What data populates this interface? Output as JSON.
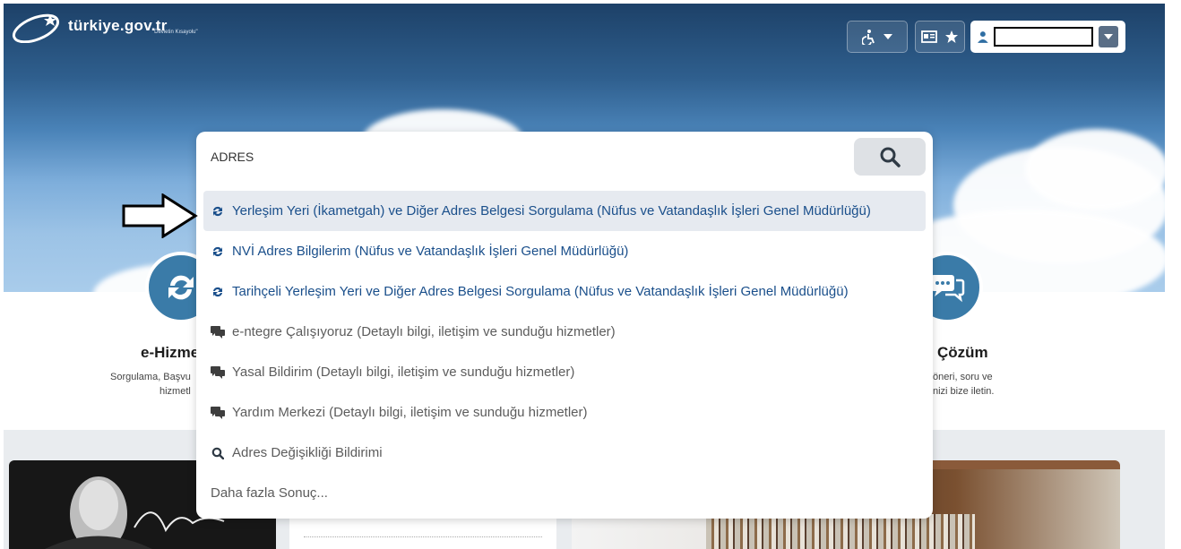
{
  "header": {
    "logo_text": "türkiye.gov.tr",
    "logo_subtext": "\"Devletin Kısayolu\"",
    "accessibility_icon": "accessibility-icon",
    "id_card_icon": "id-card-icon",
    "favorite_icon": "star-icon",
    "user_icon": "user-icon"
  },
  "services": {
    "left_title": "e-Hizmet",
    "left_desc_line1": "Sorgulama, Başvu",
    "left_desc_line2": "hizmetl",
    "right_title": "Çözüm",
    "right_desc_line1": "öneri, soru ve",
    "right_desc_line2": "nizi bize iletin."
  },
  "search": {
    "value": "ADRES",
    "button_icon": "search-icon",
    "results": [
      {
        "label": "Yerleşim Yeri (İkametgah) ve Diğer Adres Belgesi Sorgulama (Nüfus ve Vatandaşlık İşleri Genel Müdürlüğü)",
        "icon": "refresh-icon",
        "type": "service"
      },
      {
        "label": "NVİ Adres Bilgilerim (Nüfus ve Vatandaşlık İşleri Genel Müdürlüğü)",
        "icon": "refresh-icon",
        "type": "service"
      },
      {
        "label": "Tarihçeli Yerleşim Yeri ve Diğer Adres Belgesi Sorgulama (Nüfus ve Vatandaşlık İşleri Genel Müdürlüğü)",
        "icon": "refresh-icon",
        "type": "service"
      },
      {
        "label": "e-ntegre Çalışıyoruz (Detaylı bilgi, iletişim ve sunduğu hizmetler)",
        "icon": "chat-icon",
        "type": "info"
      },
      {
        "label": "Yasal Bildirim (Detaylı bilgi, iletişim ve sunduğu hizmetler)",
        "icon": "chat-icon",
        "type": "info"
      },
      {
        "label": "Yardım Merkezi (Detaylı bilgi, iletişim ve sunduğu hizmetler)",
        "icon": "chat-icon",
        "type": "info"
      },
      {
        "label": "Adres Değişikliği Bildirimi",
        "icon": "search-icon",
        "type": "search"
      },
      {
        "label": "Daha fazla Sonuç...",
        "icon": "",
        "type": "more"
      }
    ]
  },
  "colors": {
    "brand_blue": "#1a4f8b",
    "circle_blue": "#3a7ba8",
    "highlight_bg": "#e6eaf0"
  }
}
